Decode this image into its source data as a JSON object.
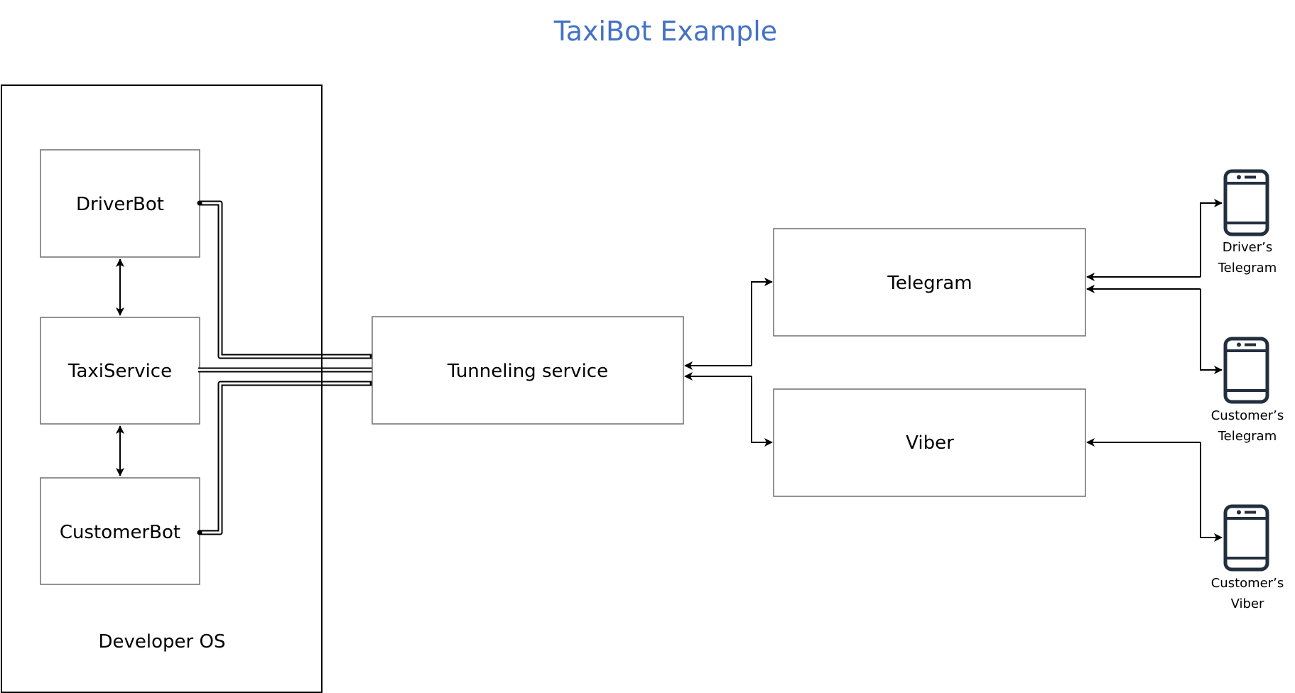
{
  "title": "TaxiBot Example",
  "colors": {
    "title": "#4472C4",
    "phone": "#232F3E",
    "line": "#000000",
    "box_border": "#6F6F6F"
  },
  "container": {
    "label": "Developer OS"
  },
  "nodes": {
    "driver_bot": "DriverBot",
    "taxi_service": "TaxiService",
    "customer_bot": "CustomerBot",
    "tunneling": "Tunneling service",
    "telegram": "Telegram",
    "viber": "Viber"
  },
  "clients": [
    {
      "icon": "smartphone-icon",
      "line1": "Driver’s",
      "line2": "Telegram"
    },
    {
      "icon": "smartphone-icon",
      "line1": "Customer’s",
      "line2": "Telegram"
    },
    {
      "icon": "smartphone-icon",
      "line1": "Customer’s",
      "line2": "Viber"
    }
  ],
  "connections": [
    {
      "from": "DriverBot",
      "to": "TaxiService",
      "type": "bidirectional"
    },
    {
      "from": "TaxiService",
      "to": "CustomerBot",
      "type": "bidirectional"
    },
    {
      "from": "DriverBot",
      "to": "Tunneling service",
      "type": "double-line"
    },
    {
      "from": "TaxiService",
      "to": "Tunneling service",
      "type": "double-line"
    },
    {
      "from": "CustomerBot",
      "to": "Tunneling service",
      "type": "double-line"
    },
    {
      "from": "Tunneling service",
      "to": "Telegram",
      "type": "arrow"
    },
    {
      "from": "Tunneling service",
      "to": "Viber",
      "type": "arrow"
    },
    {
      "from": "Telegram",
      "to": "Tunneling service",
      "type": "arrow"
    },
    {
      "from": "Viber",
      "to": "Tunneling service",
      "type": "arrow"
    },
    {
      "from": "Telegram",
      "to": "Driver’s Telegram",
      "type": "arrow"
    },
    {
      "from": "Driver’s Telegram",
      "to": "Telegram",
      "type": "arrow"
    },
    {
      "from": "Telegram",
      "to": "Customer’s Telegram",
      "type": "arrow"
    },
    {
      "from": "Customer’s Telegram",
      "to": "Telegram",
      "type": "arrow"
    },
    {
      "from": "Viber",
      "to": "Customer’s Viber",
      "type": "arrow"
    },
    {
      "from": "Customer’s Viber",
      "to": "Viber",
      "type": "arrow"
    }
  ]
}
